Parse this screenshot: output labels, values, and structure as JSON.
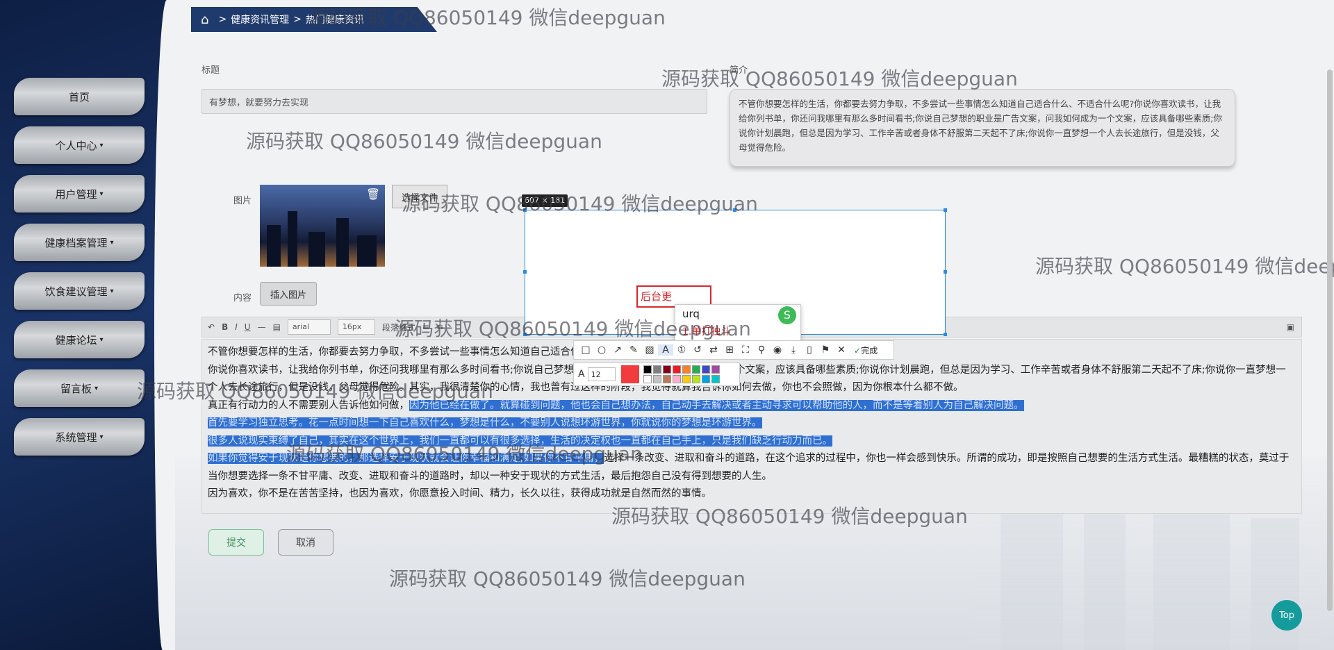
{
  "breadcrumb": {
    "items": [
      "健康资讯管理",
      "热门健康资讯"
    ]
  },
  "sidebar": {
    "items": [
      {
        "label": "首页",
        "has_caret": false
      },
      {
        "label": "个人中心",
        "has_caret": true
      },
      {
        "label": "用户管理",
        "has_caret": true
      },
      {
        "label": "健康档案管理",
        "has_caret": true
      },
      {
        "label": "饮食建议管理",
        "has_caret": true
      },
      {
        "label": "健康论坛",
        "has_caret": true
      },
      {
        "label": "留言板",
        "has_caret": true
      },
      {
        "label": "系统管理",
        "has_caret": true
      }
    ]
  },
  "form": {
    "title_label": "标题",
    "title_value": "有梦想，就要努力去实现",
    "intro_label": "简介",
    "intro_value": "不管你想要怎样的生活，你都要去努力争取，不多尝试一些事情怎么知道自己适合什么、不适合什么呢?你说你喜欢读书，让我给你列书单，你还问我哪里有那么多时间看书;你说自己梦想的职业是广告文案，问我如何成为一个文案，应该具备哪些素质;你说你计划晨跑，但总是因为学习、工作辛苦或者身体不舒服第二天起不了床;你说你一直梦想一个人去长途旅行，但是没钱，父母觉得危险。",
    "image_label": "图片",
    "file_button": "选择文件",
    "content_label": "内容",
    "insert_image_button": "插入图片",
    "submit_button": "提交",
    "cancel_button": "取消"
  },
  "editor": {
    "font_family": "arial",
    "font_size": "16px",
    "paragraph": "段落格式",
    "paragraphs": [
      {
        "text": "不管你想要怎样的生活，你都要去努力争取，不多尝试一些事情怎么知道自己适合什么、不适合什么呢?",
        "highlight": false
      },
      {
        "text": "你说你喜欢读书，让我给你列书单，你还问我哪里有那么多时间看书;你说自己梦想的职业是广告文案，问我如何成为一个文案，应该具备哪些素质;你说你计划晨跑，但总是因为学习、工作辛苦或者身体不舒服第二天起不了床;你说你一直梦想一个人去长途旅行，但是没钱，父母觉得危险。其实，我很清楚你的心情，我也曾有过这样的阶段，我觉得就算我告诉你如何去做，你也不会照做，因为你根本什么都不做。",
        "highlight": false
      },
      {
        "text": "真正有行动力的人不需要别人告诉他如何做，",
        "highlight": false,
        "tail": "因为他已经在做了。就算碰到问题，他也会自己想办法，自己动手去解决或者主动寻求可以帮助他的人，而不是等着别人为自己解决问题。"
      },
      {
        "text": "首先要学习独立思考。花一点时间想一下自己喜欢什么，梦想是什么，不要别人说想环游世界，你就说你的梦想是环游世界。",
        "highlight": true
      },
      {
        "text": "很多人说现实束缚了自己，其实在这个世界上，我们一直都可以有很多选择，生活的决定权也一直都在自己手上，只是我们缺乏行动力而已。",
        "highlight": true
      },
      {
        "text": "如果你觉得安于现状是你想要的，那选择安于现状就会让你幸福和满足;如果你不甘平庸，",
        "highlight": true,
        "tail_plain": "选择一条改变、进取和奋斗的道路，在这个追求的过程中，你也一样会感到快乐。所谓的成功，即是按照自己想要的生活方式生活。最糟糕的状态，莫过于当你想要选择一条不甘平庸、改变、进取和奋斗的道路时，却以一种安于现状的方式生活，最后抱怨自己没有得到想要的人生。"
      },
      {
        "text": "因为喜欢，你不是在苦苦坚持，也因为喜欢，你愿意投入时间、精力，长久以往，获得成功就是自然而然的事情。",
        "highlight": false
      }
    ]
  },
  "capture": {
    "size_label": "607 × 181",
    "text_value": "后台更",
    "ime_input": "urq",
    "ime_candidate": "1.单打独斗",
    "font_size": "12",
    "done_label": "完成",
    "current_color": "#f03c3c",
    "swatches": [
      "#000000",
      "#7f7f7f",
      "#880015",
      "#ed1c24",
      "#ff7f27",
      "#22b14c",
      "#3f48cc",
      "#a349a4",
      "#ffffff",
      "#c3c3c3",
      "#b97a57",
      "#ffaec9",
      "#ffc90e",
      "#b5e61d",
      "#00a2e8",
      "#00c8c8"
    ]
  },
  "watermark": "源码获取 QQ86050149 微信deepguan",
  "top_button": "Top"
}
